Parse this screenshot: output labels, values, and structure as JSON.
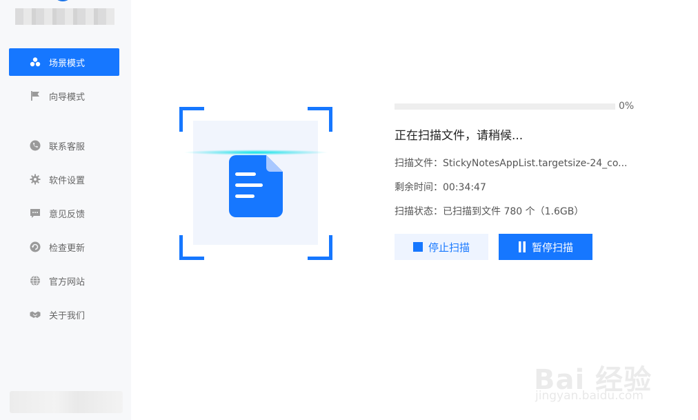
{
  "sidebar": {
    "items": [
      {
        "label": "场景模式",
        "icon": "apps-icon",
        "active": true
      },
      {
        "label": "向导模式",
        "icon": "flag-icon"
      },
      {
        "label": "联系客服",
        "icon": "phone-icon"
      },
      {
        "label": "软件设置",
        "icon": "gear-icon"
      },
      {
        "label": "意见反馈",
        "icon": "chat-icon"
      },
      {
        "label": "检查更新",
        "icon": "refresh-icon"
      },
      {
        "label": "官方网站",
        "icon": "globe-icon"
      },
      {
        "label": "关于我们",
        "icon": "handshake-icon"
      }
    ]
  },
  "scan": {
    "progress_percent": 0,
    "progress_label": "0%",
    "status_title": "正在扫描文件，请稍候...",
    "file_line": "扫描文件：StickyNotesAppList.targetsize-24_co...",
    "remaining_line": "剩余时间：00:34:47",
    "state_line": "扫描状态：已扫描到文件 780 个（1.6GB）"
  },
  "buttons": {
    "stop_label": "停止扫描",
    "pause_label": "暂停扫描"
  },
  "watermark": {
    "brand": "Bai 经验",
    "url": "jingyan.baidu.com"
  },
  "colors": {
    "accent": "#1677ff",
    "sidebar_bg": "#f7f8fa",
    "scan_glow": "#00e0e6"
  }
}
